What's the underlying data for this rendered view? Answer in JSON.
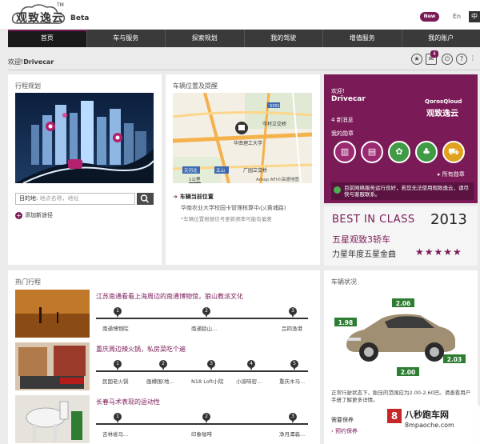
{
  "header": {
    "logo_text": "观致逸云",
    "logo_tm": "TM",
    "beta": "Beta",
    "new_badge": "New",
    "lang_en": "En",
    "lang_zh": "中"
  },
  "nav": {
    "items": [
      {
        "label": "首页",
        "active": true
      },
      {
        "label": "车与服务"
      },
      {
        "label": "探索规划"
      },
      {
        "label": "我的驾驶"
      },
      {
        "label": "增值服务"
      },
      {
        "label": "我的账户"
      }
    ]
  },
  "welcome": {
    "prefix": "欢迎!",
    "user": "Drivecar"
  },
  "toolbar": {
    "mail_count": "4"
  },
  "trip": {
    "title": "行程规划",
    "dest_label": "目的地:",
    "dest_placeholder": "地点名称，地址",
    "add_route": "添加新途径"
  },
  "location": {
    "title": "车辆位置及提醒",
    "map_labels": [
      "岑村立交桥",
      "华南理工大学",
      "华南农业大学校园卡管理核算中心(黄埔路)",
      "天河北",
      "五山",
      "广园立交桥",
      "1公里",
      "Amap AFI©高德地图"
    ],
    "map_road_no": "S301",
    "current_label": "车辆当前位置",
    "address": "华南农业大学校园卡管理核算中心(黄埔路)",
    "note": "*车辆位置根据信号更新频率可能有偏差"
  },
  "account": {
    "hello": "欢迎!",
    "name": "Drivecar",
    "brand_top": "QorosQloud",
    "brand_cn": "观致逸云",
    "msgs": "4 新消息",
    "medals_title": "我的勋章",
    "all_medals": "所有勋章",
    "note": "目前网络服务运行良好，若您无法使用观致逸云，请尽快与客服联系。"
  },
  "banner": {
    "best": "BEST IN CLASS",
    "year": "2013",
    "line1": "五星观致3轿车",
    "line2": "力星年度五星金曲",
    "stars": "★★★★★"
  },
  "hot_trips": {
    "title": "热门行程",
    "trips": [
      {
        "title": "江苏南通看看上海周边的南通博物馆，狼山教派文化",
        "stops": [
          "南通博物院",
          "南通狼山...",
          "吕四渔港"
        ]
      },
      {
        "title": "重庆周边辣火锅，私房菜吃个遍",
        "stops": [
          "民国老火锅",
          "画樽围(地...",
          "N18 Loft小院",
          "小渝味密...",
          "重庆木马..."
        ]
      },
      {
        "title": "长春马术表现的运动性",
        "stops": [
          "吉林省马...",
          "印象咖啡",
          "净月潭森..."
        ]
      }
    ]
  },
  "car": {
    "title": "车辆状况",
    "prices": [
      "2.06",
      "1.98",
      "2.03",
      "2.00"
    ],
    "note": "正常行驶状态下，胎压的范围应为2.00-2.60巴。请查看用户手册了解更多详情。",
    "maint": "需要保养",
    "reserve": "预约保养"
  },
  "watermark": {
    "logo": "8",
    "cn": "八秒跑车网",
    "url": "8mpaoche.com"
  }
}
